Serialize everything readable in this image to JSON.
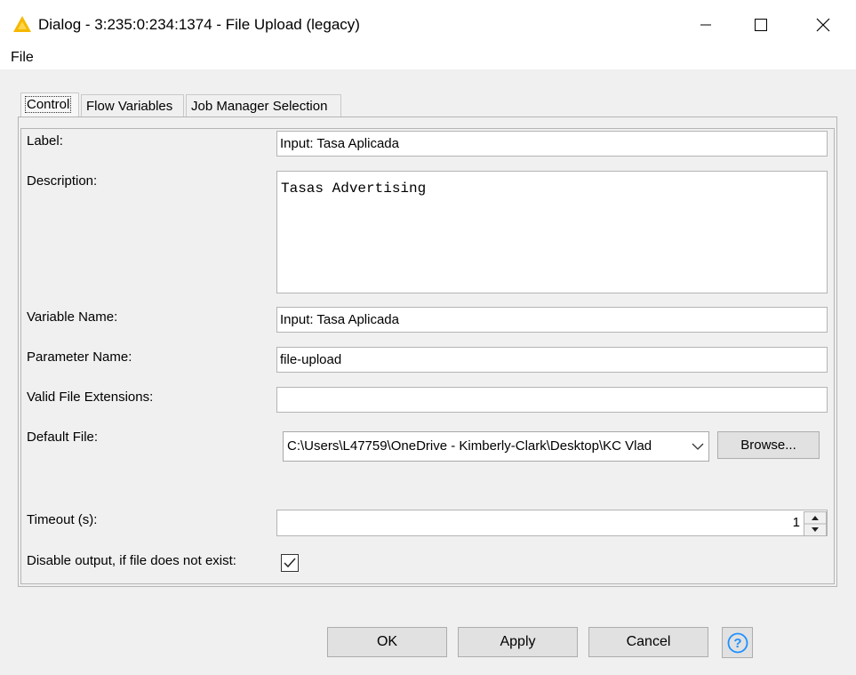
{
  "window": {
    "title": "Dialog - 3:235:0:234:1374 - File Upload (legacy)",
    "controls": [
      "minimize-icon",
      "maximize-icon",
      "close-icon"
    ]
  },
  "menu": {
    "file": "File"
  },
  "tabs": [
    {
      "label": "Control",
      "active": true
    },
    {
      "label": "Flow Variables",
      "active": false
    },
    {
      "label": "Job Manager Selection",
      "active": false
    }
  ],
  "form": {
    "label": {
      "label": "Label:",
      "value": "Input: Tasa Aplicada"
    },
    "description": {
      "label": "Description:",
      "value": "Tasas Advertising"
    },
    "variable_name": {
      "label": "Variable Name:",
      "value": "Input: Tasa Aplicada"
    },
    "parameter_name": {
      "label": "Parameter Name:",
      "value": "file-upload"
    },
    "valid_file_extensions": {
      "label": "Valid File Extensions:",
      "value": ""
    },
    "default_file": {
      "label": "Default File:",
      "value": "C:\\Users\\L47759\\OneDrive - Kimberly-Clark\\Desktop\\KC Vlad",
      "browse_label": "Browse..."
    },
    "timeout": {
      "label": "Timeout (s):",
      "value": "1"
    },
    "disable_output": {
      "label": "Disable output, if file does not exist:",
      "checked": true
    }
  },
  "footer": {
    "ok": "OK",
    "apply": "Apply",
    "cancel": "Cancel",
    "help_icon": "question-icon"
  },
  "colors": {
    "accent": "#f5b800",
    "help_blue": "#1e90ff",
    "background": "#f0f0f0"
  }
}
